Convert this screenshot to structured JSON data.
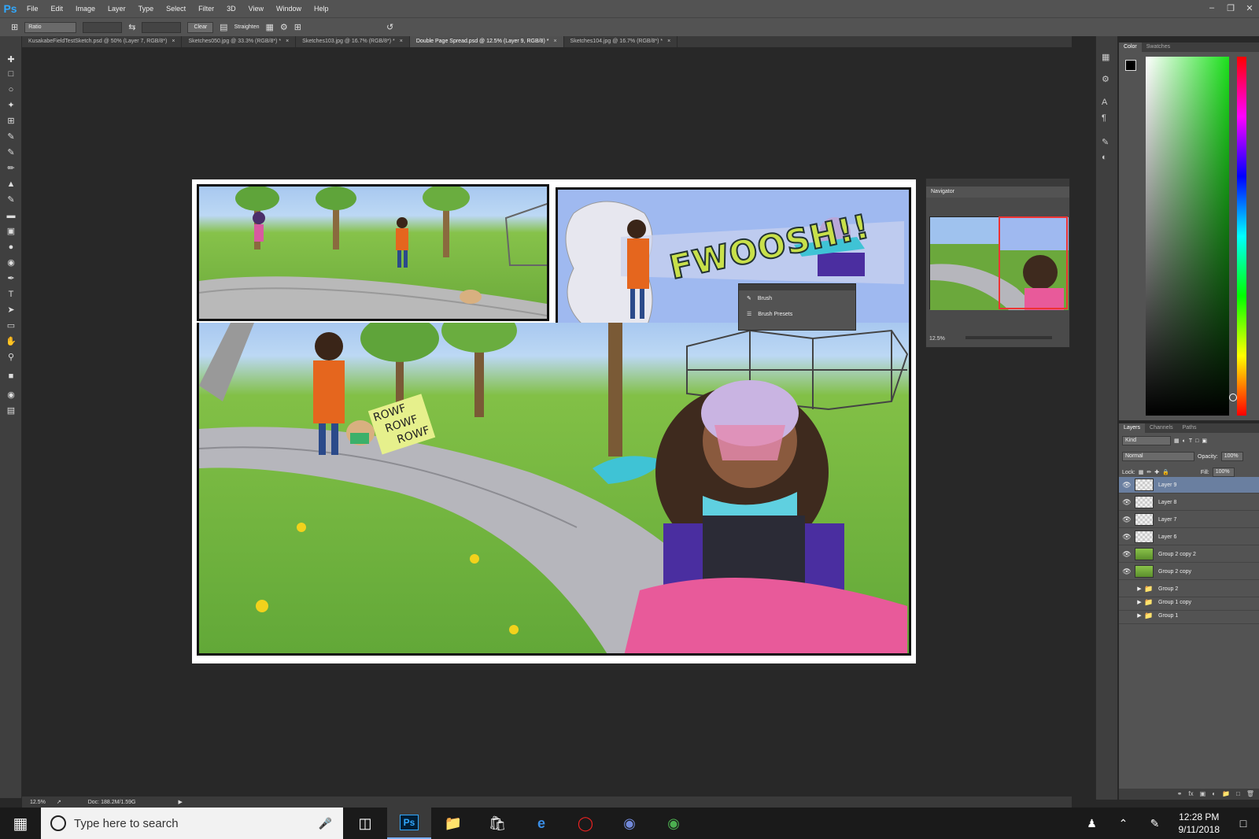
{
  "app": {
    "logo": "Ps",
    "menus": [
      "File",
      "Edit",
      "Image",
      "Layer",
      "Type",
      "Select",
      "Filter",
      "3D",
      "View",
      "Window",
      "Help"
    ]
  },
  "options_bar": {
    "ratio": "Ratio",
    "clear": "Clear",
    "straighten": "Straighten"
  },
  "tabs": [
    {
      "label": "KusakabeFieldTestSketch.psd @ 50% (Layer 7, RGB/8*)"
    },
    {
      "label": "Sketches050.jpg @ 33.3% (RGB/8*) *"
    },
    {
      "label": "Sketches103.jpg @ 16.7% (RGB/8*) *"
    },
    {
      "label": "Double Page Spread.psd @ 12.5% (Layer 9, RGB/8) *"
    },
    {
      "label": "Sketches104.jpg @ 16.7% (RGB/8*) *"
    }
  ],
  "brush_panel": {
    "items": [
      {
        "label": "Brush"
      },
      {
        "label": "Brush Presets"
      }
    ]
  },
  "comic": {
    "sfx_fwoosh": "FWOOSH!!",
    "sfx_rowf": [
      "ROWF",
      "ROWF",
      "ROWF"
    ]
  },
  "navigator": {
    "title": "Navigator",
    "zoom": "12.5%"
  },
  "color_panel": {
    "tabs": [
      "Color",
      "Swatches"
    ]
  },
  "layers_panel": {
    "tabs": [
      "Layers",
      "Channels",
      "Paths"
    ],
    "kind": "Kind",
    "blend_mode": "Normal",
    "opacity_label": "Opacity:",
    "opacity": "100%",
    "lock_label": "Lock:",
    "fill_label": "Fill:",
    "fill": "100%",
    "layers": [
      {
        "name": "Layer 9"
      },
      {
        "name": "Layer 8"
      },
      {
        "name": "Layer 7"
      },
      {
        "name": "Layer 6"
      },
      {
        "name": "Group 2 copy 2"
      },
      {
        "name": "Group 2 copy"
      },
      {
        "name": "Group 2"
      },
      {
        "name": "Group 1 copy"
      },
      {
        "name": "Group 1"
      }
    ]
  },
  "status": {
    "zoom": "12.5%",
    "doc": "Doc: 188.2M/1.59G"
  },
  "taskbar": {
    "search_placeholder": "Type here to search",
    "time": "12:28 PM",
    "date": "9/11/2018"
  }
}
